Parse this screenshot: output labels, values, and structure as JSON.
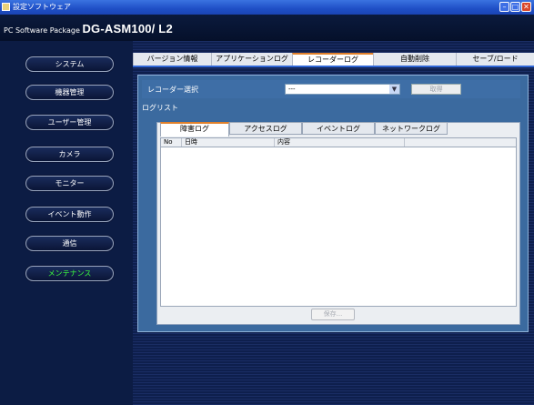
{
  "titlebar": {
    "title": "設定ソフトウェア"
  },
  "header": {
    "prefix": "PC Software Package ",
    "model": "DG-ASM100/ L2"
  },
  "sidebar": {
    "items": [
      {
        "label": "システム"
      },
      {
        "label": "機器管理"
      },
      {
        "label": "ユーザー管理"
      },
      {
        "label": "カメラ"
      },
      {
        "label": "モニター"
      },
      {
        "label": "イベント動作"
      },
      {
        "label": "通信"
      },
      {
        "label": "メンテナンス",
        "active": true
      }
    ]
  },
  "top_tabs": [
    {
      "label": "バージョン情報"
    },
    {
      "label": "アプリケーションログ"
    },
    {
      "label": "レコーダーログ",
      "active": true
    },
    {
      "label": "自動削除"
    },
    {
      "label": "セーブ/ロード"
    }
  ],
  "recorder": {
    "label": "レコーダー選択",
    "selected": "---",
    "get_button": "取得"
  },
  "loglist_label": "ログリスト",
  "log_tabs": [
    {
      "label": "障害ログ",
      "active": true
    },
    {
      "label": "アクセスログ"
    },
    {
      "label": "イベントログ"
    },
    {
      "label": "ネットワークログ"
    }
  ],
  "table": {
    "columns": [
      "No",
      "日時",
      "内容",
      ""
    ],
    "rows": []
  },
  "save_button": "保存...",
  "colors": {
    "active_nav": "#3cff3c",
    "tab_accent": "#e0802a",
    "tab_underline": "#2f66d6"
  }
}
